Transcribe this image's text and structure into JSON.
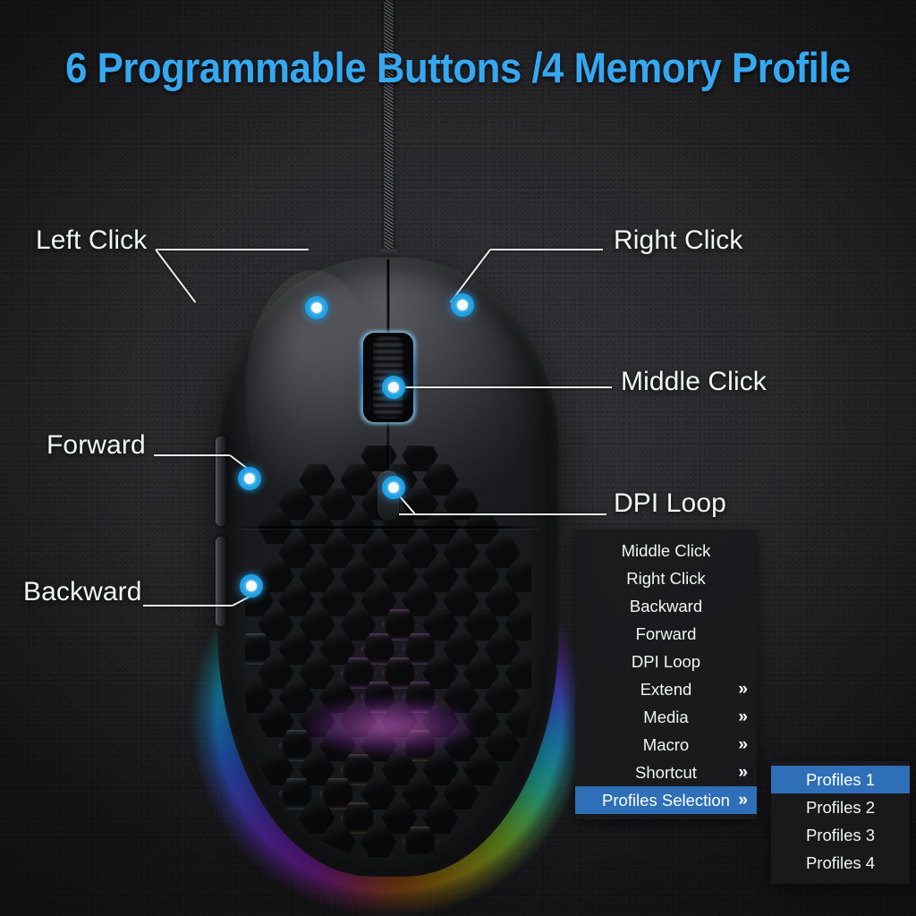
{
  "title": "6 Programmable Buttons /4 Memory Profile",
  "theme": {
    "title_blue": "#35a8f0",
    "marker_blue": "#1f9fe4",
    "highlight_blue": "#2e6fb8",
    "label_white": "#f4f5f6",
    "background": "#2c2c30",
    "menu_background": "#1a1a1d"
  },
  "callouts": [
    {
      "id": "left-click",
      "label": "Left Click"
    },
    {
      "id": "right-click",
      "label": "Right Click"
    },
    {
      "id": "middle-click",
      "label": "Middle Click"
    },
    {
      "id": "forward",
      "label": "Forward"
    },
    {
      "id": "dpi-loop",
      "label": "DPI Loop"
    },
    {
      "id": "backward",
      "label": "Backward"
    }
  ],
  "context_menu": {
    "items": [
      {
        "label": "Middle Click",
        "submenu_arrow": "",
        "selected": false
      },
      {
        "label": "Right Click",
        "submenu_arrow": "",
        "selected": false
      },
      {
        "label": "Backward",
        "submenu_arrow": "",
        "selected": false
      },
      {
        "label": "Forward",
        "submenu_arrow": "",
        "selected": false
      },
      {
        "label": "DPI Loop",
        "submenu_arrow": "",
        "selected": false
      },
      {
        "label": "Extend",
        "submenu_arrow": "»",
        "selected": false
      },
      {
        "label": "Media",
        "submenu_arrow": "»",
        "selected": false
      },
      {
        "label": "Macro",
        "submenu_arrow": "»",
        "selected": false
      },
      {
        "label": "Shortcut",
        "submenu_arrow": "»",
        "selected": false
      },
      {
        "label": "Profiles Selection",
        "submenu_arrow": "»",
        "selected": true
      }
    ]
  },
  "profiles_submenu": {
    "items": [
      {
        "label": "Profiles 1",
        "selected": true
      },
      {
        "label": "Profiles 2",
        "selected": false
      },
      {
        "label": "Profiles 3",
        "selected": false
      },
      {
        "label": "Profiles 4",
        "selected": false
      }
    ]
  }
}
